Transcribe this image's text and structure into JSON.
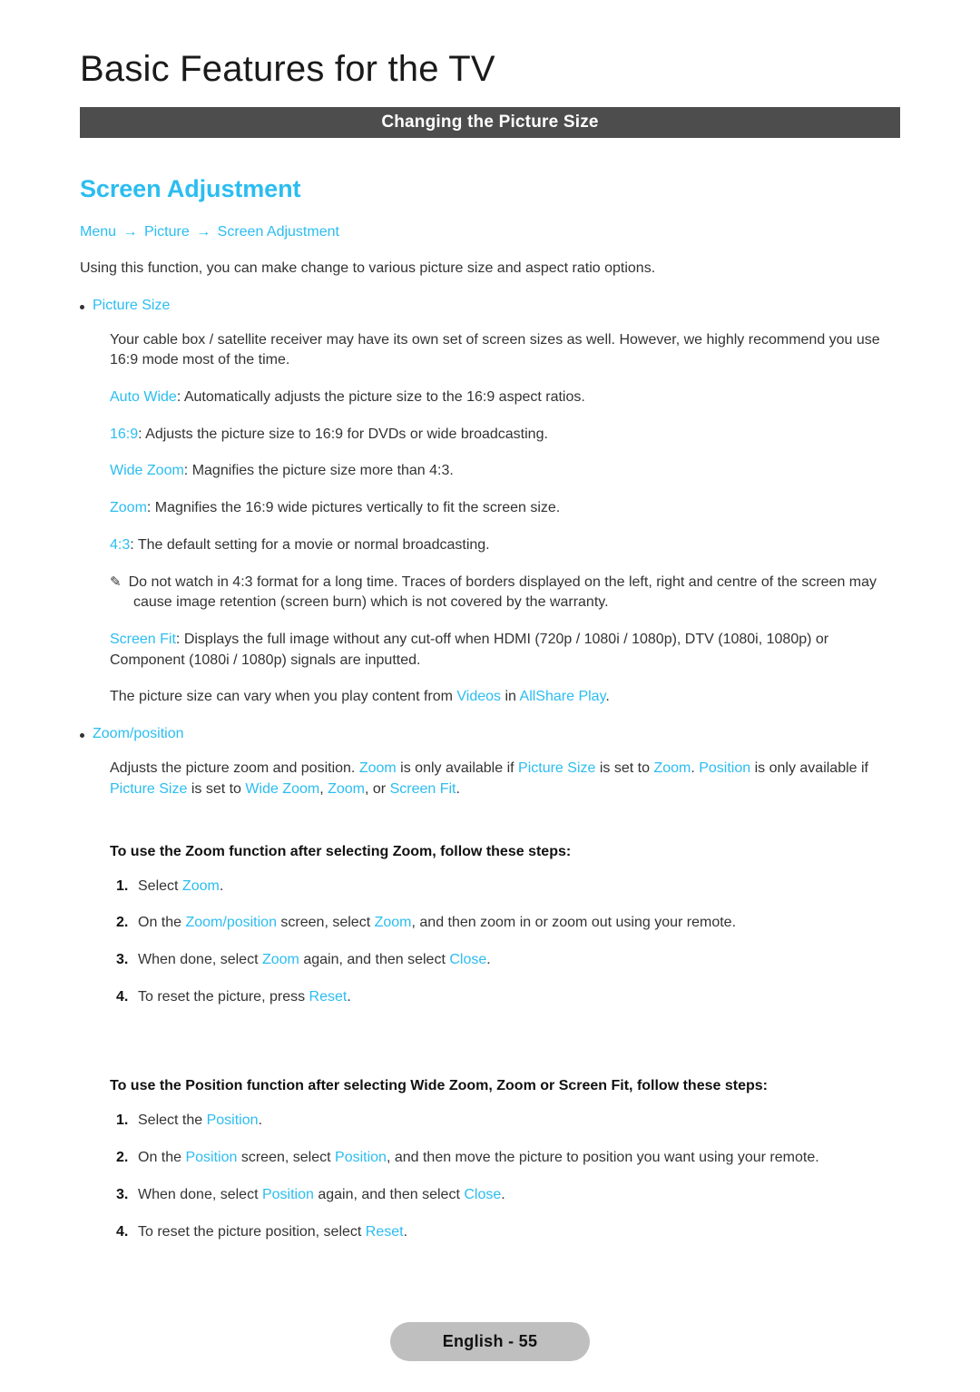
{
  "chapter": {
    "title": "Basic Features for the TV"
  },
  "section_bar": {
    "label": "Changing the Picture Size"
  },
  "heading": {
    "title": "Screen Adjustment"
  },
  "breadcrumb": {
    "items": [
      "Menu",
      "Picture",
      "Screen Adjustment"
    ],
    "separator": "→"
  },
  "intro": "Using this function, you can make change to various picture size and aspect ratio options.",
  "picture_size": {
    "bullet_label": "Picture Size",
    "paragraph": "Your cable box / satellite receiver may have its own set of screen sizes as well. However, we highly recommend you use 16:9 mode most of the time.",
    "options": [
      {
        "term": "Auto Wide",
        "desc": ": Automatically adjusts the picture size to the 16:9 aspect ratios."
      },
      {
        "term": "16:9",
        "desc": ": Adjusts the picture size to 16:9 for DVDs or wide broadcasting."
      },
      {
        "term": "Wide Zoom",
        "desc": ": Magnifies the picture size more than 4:3."
      },
      {
        "term": "Zoom",
        "desc": ": Magnifies the 16:9 wide pictures vertically to fit the screen size."
      },
      {
        "term": "4:3",
        "desc": ": The default setting for a movie or normal broadcasting."
      }
    ],
    "note_icon": "✎",
    "note": "Do not watch in 4:3 format for a long time. Traces of borders displayed on the left, right and centre of the screen may cause image retention (screen burn) which is not covered by the warranty.",
    "screen_fit_term": "Screen Fit",
    "screen_fit_desc": ": Displays the full image without any cut-off when HDMI (720p / 1080i / 1080p), DTV (1080i, 1080p) or Component (1080i / 1080p) signals are inputted.",
    "allshare_pre": "The picture size can vary when you play content from ",
    "allshare_videos": "Videos",
    "allshare_mid": " in ",
    "allshare_play": "AllShare Play",
    "allshare_end": "."
  },
  "zoom_position": {
    "bullet_label": "Zoom/position",
    "p1_a": "Adjusts the picture zoom and position. ",
    "p1_zoom1": "Zoom",
    "p1_b": " is only available if ",
    "p1_picsize1": "Picture Size",
    "p1_c": " is set to ",
    "p1_zoom2": "Zoom",
    "p1_d": ". ",
    "p1_position": "Position",
    "p1_e": " is only available if ",
    "p1_picsize2": "Picture Size",
    "p1_f": " is set to ",
    "p1_widezoom": "Wide Zoom",
    "p1_g": ", ",
    "p1_zoom3": "Zoom",
    "p1_h": ", or ",
    "p1_screenfit": "Screen Fit",
    "p1_i": "."
  },
  "zoom_steps": {
    "heading": "To use the Zoom function after selecting Zoom, follow these steps:",
    "items": [
      {
        "num": "1.",
        "a": "Select ",
        "link1": "Zoom",
        "b": ".",
        "link2": "",
        "c": ""
      },
      {
        "num": "2.",
        "a": "On the ",
        "link1": "Zoom/position",
        "b": " screen, select ",
        "link2": "Zoom",
        "c": ", and then zoom in or zoom out using your remote."
      },
      {
        "num": "3.",
        "a": "When done, select ",
        "link1": "Zoom",
        "b": " again, and then select ",
        "link2": "Close",
        "c": "."
      },
      {
        "num": "4.",
        "a": "To reset the picture, press ",
        "link1": "Reset",
        "b": ".",
        "link2": "",
        "c": ""
      }
    ]
  },
  "position_steps": {
    "heading": "To use the Position function after selecting Wide Zoom, Zoom or Screen Fit, follow these steps:",
    "items": [
      {
        "num": "1.",
        "a": "Select the ",
        "link1": "Position",
        "b": ".",
        "link2": "",
        "c": ""
      },
      {
        "num": "2.",
        "a": "On the ",
        "link1": "Position",
        "b": " screen, select ",
        "link2": "Position",
        "c": ", and then move the picture to position you want using your remote."
      },
      {
        "num": "3.",
        "a": "When done, select ",
        "link1": "Position",
        "b": " again, and then select ",
        "link2": "Close",
        "c": "."
      },
      {
        "num": "4.",
        "a": "To reset the picture position, select ",
        "link1": "Reset",
        "b": ".",
        "link2": "",
        "c": ""
      }
    ]
  },
  "footer": {
    "label": "English - 55"
  },
  "colors": {
    "accent": "#2bbdf0",
    "bar": "#4d4d4d",
    "body_text": "#333333",
    "footer_pill": "#bfbfbf"
  }
}
